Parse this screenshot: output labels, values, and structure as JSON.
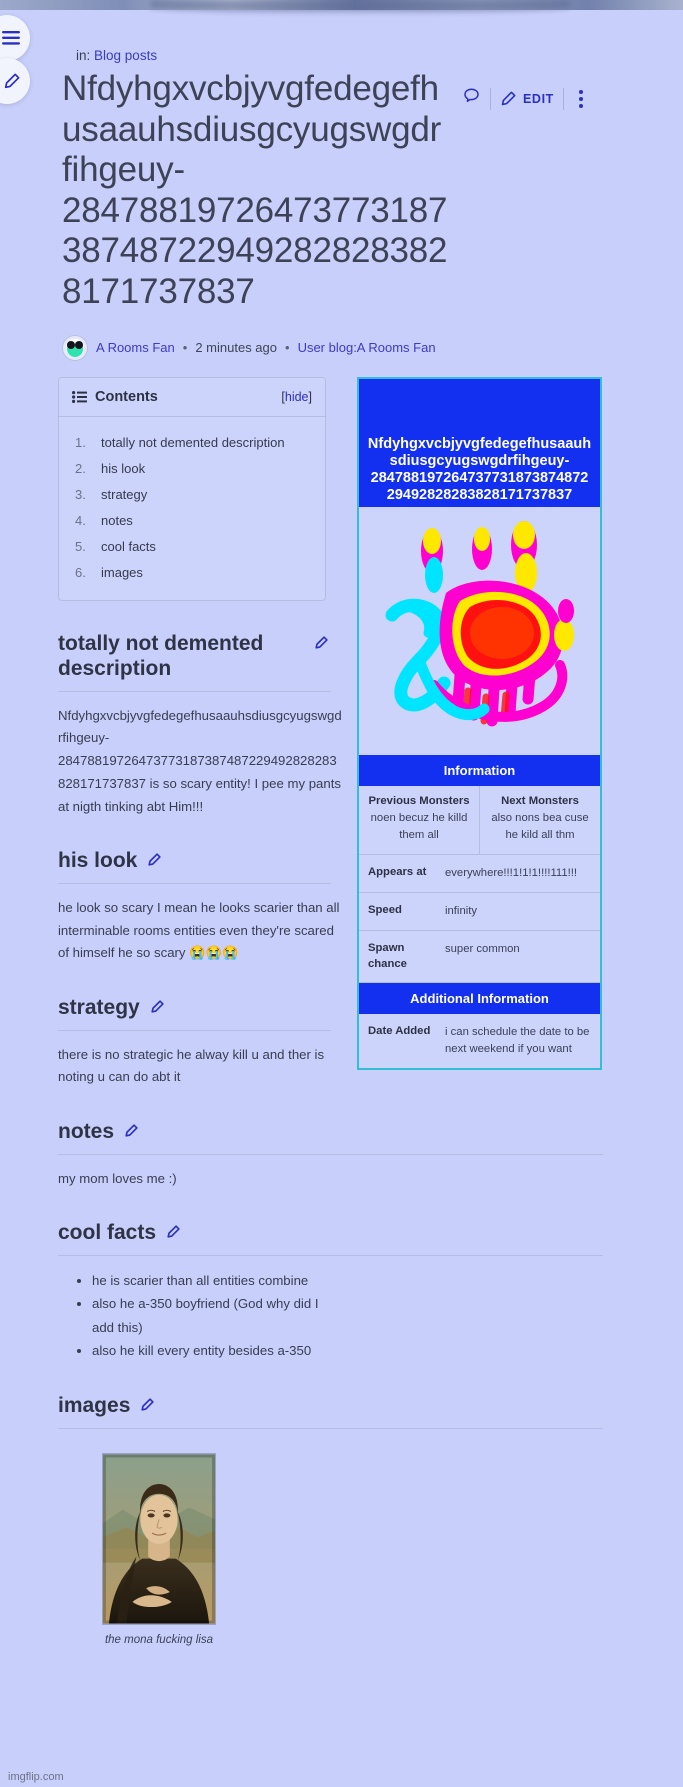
{
  "breadcrumb": {
    "prefix": "in:",
    "category": "Blog posts"
  },
  "page": {
    "title": "Nfdyhgxvcbjyvgfedegefhusaauhsdiusgcyugswgdr fihgeuy-28478819726473773187387487229492828283828171737837",
    "edit_label": "EDIT"
  },
  "byline": {
    "author": "A Rooms Fan",
    "separator1": "•",
    "time": "2 minutes ago",
    "separator2": "•",
    "blog_link": "User blog:A Rooms Fan"
  },
  "toc": {
    "title": "Contents",
    "hide_open": "[",
    "hide": "hide",
    "hide_close": "]",
    "items": [
      "totally not demented description",
      "his look",
      "strategy",
      "notes",
      "cool facts",
      "images"
    ]
  },
  "sections": [
    {
      "heading": "totally not demented description",
      "text": "Nfdyhgxvcbjyvgfedegefhusaauhsdiusgcyugswgdrfihgeuy-28478819726473773187387487229492828283828171737837 is so scary entity! I pee my pants at nigth tinking abt Him!!!"
    },
    {
      "heading": "his look",
      "text": "he look so scary I mean he looks scarier than all interminable rooms entities even they're scared of himself he so scary 😭😭😭"
    },
    {
      "heading": "strategy",
      "text": "there is no strategic he alway kill u and ther is noting u can do abt it"
    },
    {
      "heading": "notes",
      "text": "my mom loves me :)"
    },
    {
      "heading": "cool facts",
      "bullets": [
        "he is scarier than all entities combine",
        "also he a-350 boyfriend (God why did I add this)",
        "also he kill every entity besides a-350"
      ]
    },
    {
      "heading": "images"
    }
  ],
  "infobox": {
    "title": "Nfdyhgxvcbjyvgfedegefhusaauhsdiusgcyugswgdrfihgeuy-28478819726473773187387487229492828283828171737837",
    "section_information": "Information",
    "section_additional": "Additional Information",
    "previous_monsters_label": "Previous Monsters",
    "previous_monsters_value": "noen becuz he killd them all",
    "next_monsters_label": "Next Monsters",
    "next_monsters_value": "also nons bea cuse he kild all thm",
    "rows": [
      {
        "key": "Appears at",
        "value": "everywhere!!!1!1!1!!!!111!!!"
      },
      {
        "key": "Speed",
        "value": "infinity"
      },
      {
        "key": "Spawn chance",
        "value": "super common"
      }
    ],
    "additional_rows": [
      {
        "key": "Date Added",
        "value": "i can schedule the date to be next weekend if you want"
      }
    ]
  },
  "figure": {
    "caption": "the mona fucking lisa"
  },
  "watermark": "imgflip.com",
  "colors": {
    "page_bg": "#c8cffa",
    "infobox_blue": "#1330f0",
    "infobox_border": "#35bcd6",
    "link": "#3a3cc8",
    "accent": "#2b2fc4"
  }
}
